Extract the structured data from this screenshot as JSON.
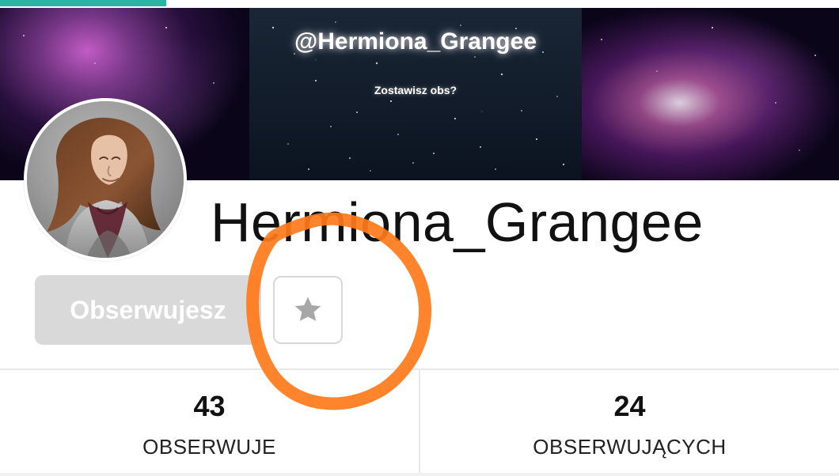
{
  "theme": {
    "accent": "#2bb3a3",
    "annotation_stroke": "#ff7a1a",
    "follow_button_bg": "#d9d9d9",
    "follow_button_text": "#ffffff"
  },
  "banner": {
    "handle": "@Hermiona_Grangee",
    "subtitle": "Zostawisz obs?"
  },
  "profile": {
    "username": "Hermiona_Grangee"
  },
  "actions": {
    "follow_label": "Obserwujesz",
    "favorite_icon": "star-icon"
  },
  "stats": {
    "following_value": "43",
    "following_label": "OBSERWUJE",
    "followers_value": "24",
    "followers_label": "OBSERWUJĄCYCH"
  }
}
